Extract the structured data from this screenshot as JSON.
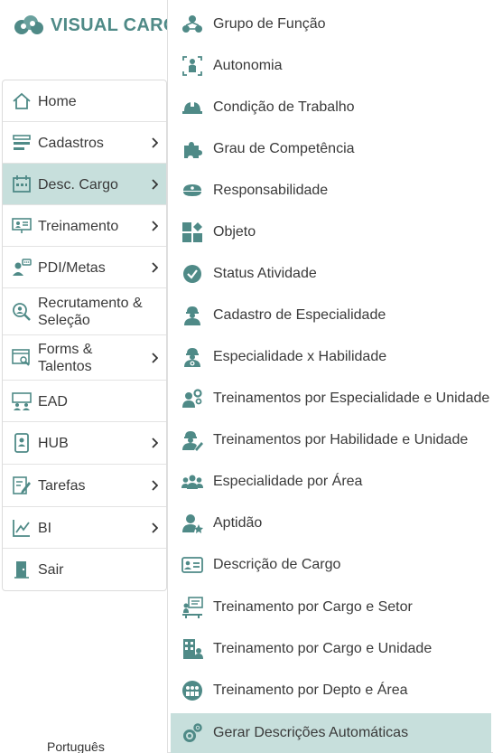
{
  "brand": {
    "name": "VISUAL CARGO",
    "accent": "#4f8a87",
    "active_bg": "#c7dfdc"
  },
  "sidebar": {
    "items": [
      {
        "label": "Home",
        "icon": "home-icon",
        "has_submenu": false
      },
      {
        "label": "Cadastros",
        "icon": "list-icon",
        "has_submenu": true
      },
      {
        "label": "Desc. Cargo",
        "icon": "calendar-icon",
        "has_submenu": true,
        "active": true
      },
      {
        "label": "Treinamento",
        "icon": "presentation-icon",
        "has_submenu": true
      },
      {
        "label": "PDI/Metas",
        "icon": "person-chat-icon",
        "has_submenu": true
      },
      {
        "label": "Recrutamento & Seleção",
        "icon": "search-person-icon",
        "has_submenu": false
      },
      {
        "label": "Forms & Talentos",
        "icon": "browser-search-icon",
        "has_submenu": true
      },
      {
        "label": "EAD",
        "icon": "classroom-icon",
        "has_submenu": false
      },
      {
        "label": "HUB",
        "icon": "phone-person-icon",
        "has_submenu": true
      },
      {
        "label": "Tarefas",
        "icon": "edit-doc-icon",
        "has_submenu": true
      },
      {
        "label": "BI",
        "icon": "chart-icon",
        "has_submenu": true
      },
      {
        "label": "Sair",
        "icon": "exit-door-icon",
        "has_submenu": false
      }
    ]
  },
  "submenu": {
    "items": [
      {
        "label": "Grupo de Função",
        "icon": "group-icon"
      },
      {
        "label": "Autonomia",
        "icon": "autonomy-icon"
      },
      {
        "label": "Condição de Trabalho",
        "icon": "hardhat-icon"
      },
      {
        "label": "Grau de Competência",
        "icon": "puzzle-icon"
      },
      {
        "label": "Responsabilidade",
        "icon": "cap-icon"
      },
      {
        "label": "Objeto",
        "icon": "shapes-icon"
      },
      {
        "label": "Status Atividade",
        "icon": "check-circle-icon"
      },
      {
        "label": "Cadastro de Especialidade",
        "icon": "worker-icon"
      },
      {
        "label": "Especialidade x Habilidade",
        "icon": "worker-gear-icon"
      },
      {
        "label": "Treinamentos por Especialidade e Unidade",
        "icon": "user-gears-icon"
      },
      {
        "label": "Treinamentos por Habilidade e Unidade",
        "icon": "worker-edit-icon"
      },
      {
        "label": "Especialidade por Área",
        "icon": "users-icon"
      },
      {
        "label": "Aptidão",
        "icon": "user-star-icon"
      },
      {
        "label": "Descrição de Cargo",
        "icon": "id-card-icon"
      },
      {
        "label": "Treinamento por Cargo e Setor",
        "icon": "teacher-board-icon"
      },
      {
        "label": "Treinamento por Cargo e Unidade",
        "icon": "building-user-icon"
      },
      {
        "label": "Treinamento por Depto e Área",
        "icon": "people-circle-icon"
      },
      {
        "label": "Gerar Descrições Automáticas",
        "icon": "gears-icon",
        "active": true
      }
    ]
  },
  "footer": {
    "language": "Português"
  }
}
